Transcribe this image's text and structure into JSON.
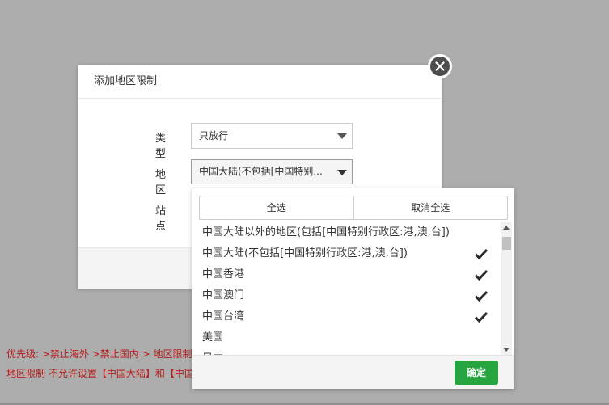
{
  "notes": {
    "line1": "优先级: >禁止海外 >禁止国内 > 地区限制 ,",
    "line2": "地区限制 不允许设置【中国大陆】和【中国"
  },
  "modal": {
    "title": "添加地区限制",
    "labels": {
      "type": "类型",
      "region": "地区",
      "site": "站点"
    },
    "type_select": {
      "value": "只放行"
    },
    "region_select": {
      "value": "中国大陆(不包括[中国特别..."
    }
  },
  "dropdown": {
    "select_all": "全选",
    "deselect_all": "取消全选",
    "items": [
      {
        "label": "中国大陆以外的地区(包括[中国特别行政区:港,澳,台])",
        "checked": false
      },
      {
        "label": "中国大陆(不包括[中国特别行政区:港,澳,台])",
        "checked": true
      },
      {
        "label": "中国香港",
        "checked": true
      },
      {
        "label": "中国澳门",
        "checked": true
      },
      {
        "label": "中国台湾",
        "checked": true
      },
      {
        "label": "美国",
        "checked": false
      },
      {
        "label": "日本",
        "checked": false
      }
    ],
    "confirm": "确定"
  },
  "colors": {
    "accent": "#25a43f",
    "note_text": "#b81c1c",
    "overlay": "#adadad"
  },
  "icons": {
    "close": "close-icon",
    "caret": "caret-down-icon",
    "check": "check-icon"
  }
}
